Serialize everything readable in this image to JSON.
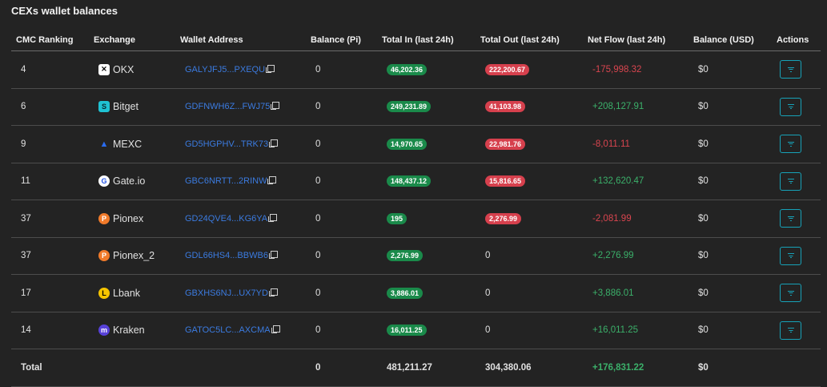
{
  "page": {
    "title": "CEXs wallet balances"
  },
  "columns": [
    "CMC Ranking",
    "Exchange",
    "Wallet Address",
    "Balance (Pi)",
    "Total In (last 24h)",
    "Total Out (last 24h)",
    "Net Flow (last 24h)",
    "Balance (USD)",
    "Actions"
  ],
  "rows": [
    {
      "rank": "4",
      "exchange": "OKX",
      "logo": "okx-logo-icon",
      "wallet": "GALYJFJ5...PXEQU",
      "balance_pi": "0",
      "total_in": "46,202.36",
      "total_out": "222,200.67",
      "net_flow": "-175,998.32",
      "net_sign": "neg",
      "balance_usd": "$0"
    },
    {
      "rank": "6",
      "exchange": "Bitget",
      "logo": "bitget-logo-icon",
      "wallet": "GDFNWH6Z...FWJ75",
      "balance_pi": "0",
      "total_in": "249,231.89",
      "total_out": "41,103.98",
      "net_flow": "+208,127.91",
      "net_sign": "pos",
      "balance_usd": "$0"
    },
    {
      "rank": "9",
      "exchange": "MEXC",
      "logo": "mexc-logo-icon",
      "wallet": "GD5HGPHV...TRK73",
      "balance_pi": "0",
      "total_in": "14,970.65",
      "total_out": "22,981.76",
      "net_flow": "-8,011.11",
      "net_sign": "neg",
      "balance_usd": "$0"
    },
    {
      "rank": "11",
      "exchange": "Gate.io",
      "logo": "gateio-logo-icon",
      "wallet": "GBC6NRTT...2RINW",
      "balance_pi": "0",
      "total_in": "148,437.12",
      "total_out": "15,816.65",
      "net_flow": "+132,620.47",
      "net_sign": "pos",
      "balance_usd": "$0"
    },
    {
      "rank": "37",
      "exchange": "Pionex",
      "logo": "pionex-logo-icon",
      "wallet": "GD24QVE4...KG6YA",
      "balance_pi": "0",
      "total_in": "195",
      "total_out": "2,276.99",
      "net_flow": "-2,081.99",
      "net_sign": "neg",
      "balance_usd": "$0"
    },
    {
      "rank": "37",
      "exchange": "Pionex_2",
      "logo": "pionex-logo-icon",
      "wallet": "GDL66HS4...BBWB6",
      "balance_pi": "0",
      "total_in": "2,276.99",
      "total_out": "0",
      "net_flow": "+2,276.99",
      "net_sign": "pos",
      "balance_usd": "$0"
    },
    {
      "rank": "17",
      "exchange": "Lbank",
      "logo": "lbank-logo-icon",
      "wallet": "GBXHS6NJ...UX7YD",
      "balance_pi": "0",
      "total_in": "3,886.01",
      "total_out": "0",
      "net_flow": "+3,886.01",
      "net_sign": "pos",
      "balance_usd": "$0"
    },
    {
      "rank": "14",
      "exchange": "Kraken",
      "logo": "kraken-logo-icon",
      "wallet": "GATOC5LC...AXCMA",
      "balance_pi": "0",
      "total_in": "16,011.25",
      "total_out": "0",
      "net_flow": "+16,011.25",
      "net_sign": "pos",
      "balance_usd": "$0"
    }
  ],
  "total": {
    "label": "Total",
    "balance_pi": "0",
    "total_in": "481,211.27",
    "total_out": "304,380.06",
    "net_flow": "+176,831.22",
    "balance_usd": "$0"
  },
  "colors": {
    "positive": "#3bb06a",
    "negative": "#d9454f",
    "badge_in": "#1a8a4a",
    "badge_out": "#d6404d",
    "link": "#3b7be0",
    "action_border": "#17a2b8",
    "background": "#232323"
  }
}
